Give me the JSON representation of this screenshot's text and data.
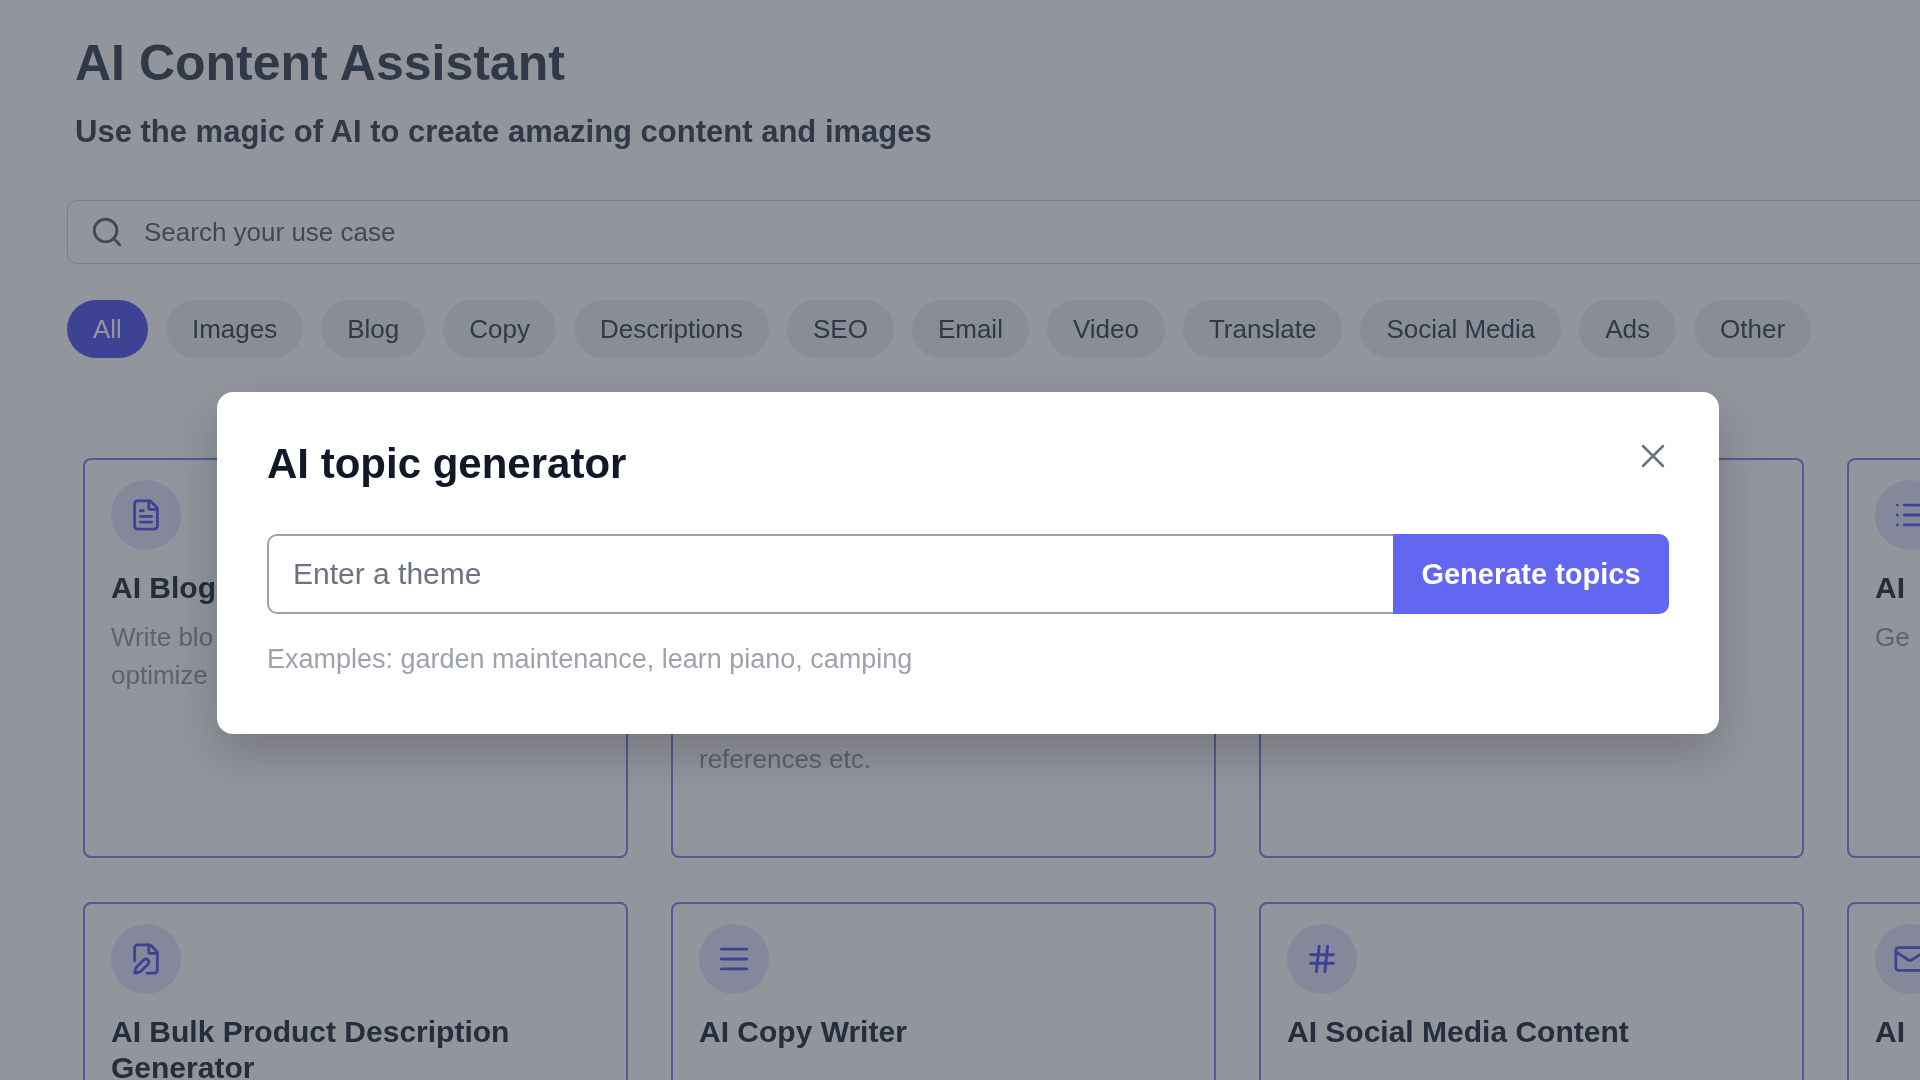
{
  "header": {
    "title": "AI Content Assistant",
    "subtitle": "Use the magic of AI to create amazing content and images"
  },
  "search": {
    "placeholder": "Search your use case"
  },
  "categories": [
    {
      "label": "All",
      "selected": true
    },
    {
      "label": "Images",
      "selected": false
    },
    {
      "label": "Blog",
      "selected": false
    },
    {
      "label": "Copy",
      "selected": false
    },
    {
      "label": "Descriptions",
      "selected": false
    },
    {
      "label": "SEO",
      "selected": false
    },
    {
      "label": "Email",
      "selected": false
    },
    {
      "label": "Video",
      "selected": false
    },
    {
      "label": "Translate",
      "selected": false
    },
    {
      "label": "Social Media",
      "selected": false
    },
    {
      "label": "Ads",
      "selected": false
    },
    {
      "label": "Other",
      "selected": false
    }
  ],
  "cards": [
    [
      {
        "kind": "use_case",
        "title": "AI Blog",
        "description_lines": [
          "Write blo",
          "optimize"
        ]
      },
      {
        "kind": "use_case",
        "description_lines": [
          "references etc."
        ]
      },
      {
        "kind": "blank"
      },
      {
        "kind": "use_case",
        "title": "AI",
        "description_lines": [
          "Ge"
        ]
      }
    ],
    [
      {
        "kind": "use_case",
        "title": "AI Bulk Product Description Generator"
      },
      {
        "kind": "use_case",
        "title": "AI Copy Writer"
      },
      {
        "kind": "use_case",
        "title": "AI Social Media Content"
      },
      {
        "kind": "use_case",
        "title": "AI"
      }
    ]
  ],
  "modal": {
    "title": "AI topic generator",
    "input": {
      "placeholder": "Enter a theme"
    },
    "button": "Generate topics",
    "hint": "Examples: garden maintenance, learn piano, camping"
  }
}
